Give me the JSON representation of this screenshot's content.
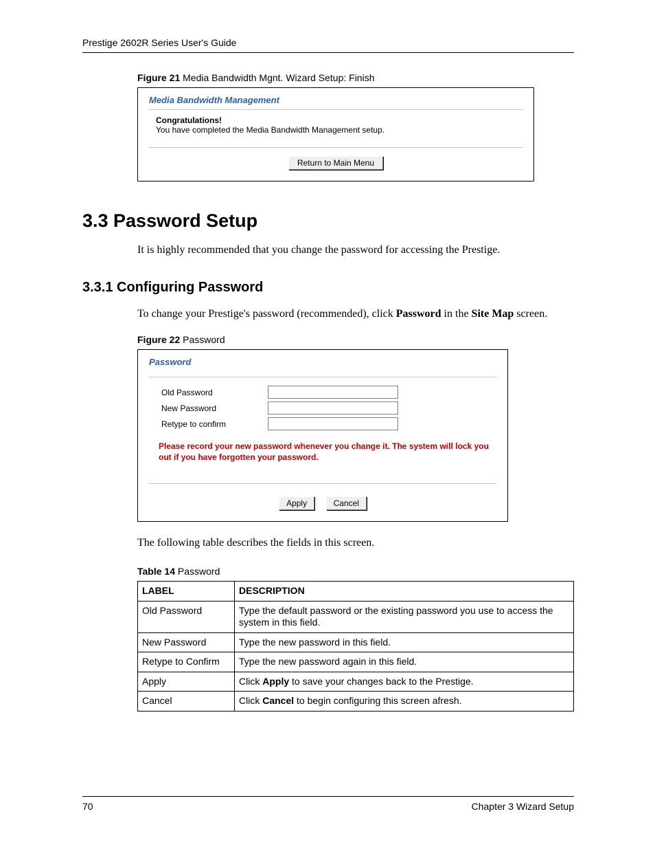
{
  "header": {
    "guide_title": "Prestige 2602R Series User's Guide"
  },
  "figure21": {
    "caption_bold": "Figure 21",
    "caption_rest": "   Media Bandwidth Mgnt. Wizard Setup: Finish",
    "box_title": "Media Bandwidth Management",
    "congrats": "Congratulations!",
    "congrats_text": "You have completed the Media Bandwidth Management setup.",
    "return_btn": "Return to Main Menu"
  },
  "sections": {
    "h2": "3.3  Password Setup",
    "p1": "It is highly recommended that you change the password for accessing the Prestige.",
    "h3": "3.3.1  Configuring Password",
    "p2_pre": "To change your Prestige's password (recommended), click ",
    "p2_bold1": "Password",
    "p2_mid": " in the ",
    "p2_bold2": "Site Map",
    "p2_end": " screen."
  },
  "figure22": {
    "caption_bold": "Figure 22",
    "caption_rest": "   Password",
    "box_title": "Password",
    "labels": {
      "old": "Old Password",
      "newp": "New Password",
      "retype": "Retype to confirm"
    },
    "warning": "Please record your new password whenever you change it. The system will lock you out if you have forgotten your password.",
    "apply_btn": "Apply",
    "cancel_btn": "Cancel"
  },
  "table_intro": "The following table describes the fields in this screen.",
  "table14": {
    "caption_bold": "Table 14",
    "caption_rest": "   Password",
    "head_label": "LABEL",
    "head_desc": "DESCRIPTION",
    "rows": {
      "r0_label": "Old Password",
      "r0_desc": "Type the default password or the existing password you use to access the system in this field.",
      "r1_label": "New Password",
      "r1_desc": "Type the new password in this field.",
      "r2_label": "Retype to Confirm",
      "r2_desc": "Type the new password again in this field.",
      "r3_label": "Apply",
      "r3_pre": "Click ",
      "r3_bold": "Apply",
      "r3_post": " to save your changes back to the Prestige.",
      "r4_label": "Cancel",
      "r4_pre": "Click ",
      "r4_bold": "Cancel",
      "r4_post": " to begin configuring this screen afresh."
    }
  },
  "footer": {
    "page_no": "70",
    "chapter": "Chapter 3 Wizard Setup"
  }
}
